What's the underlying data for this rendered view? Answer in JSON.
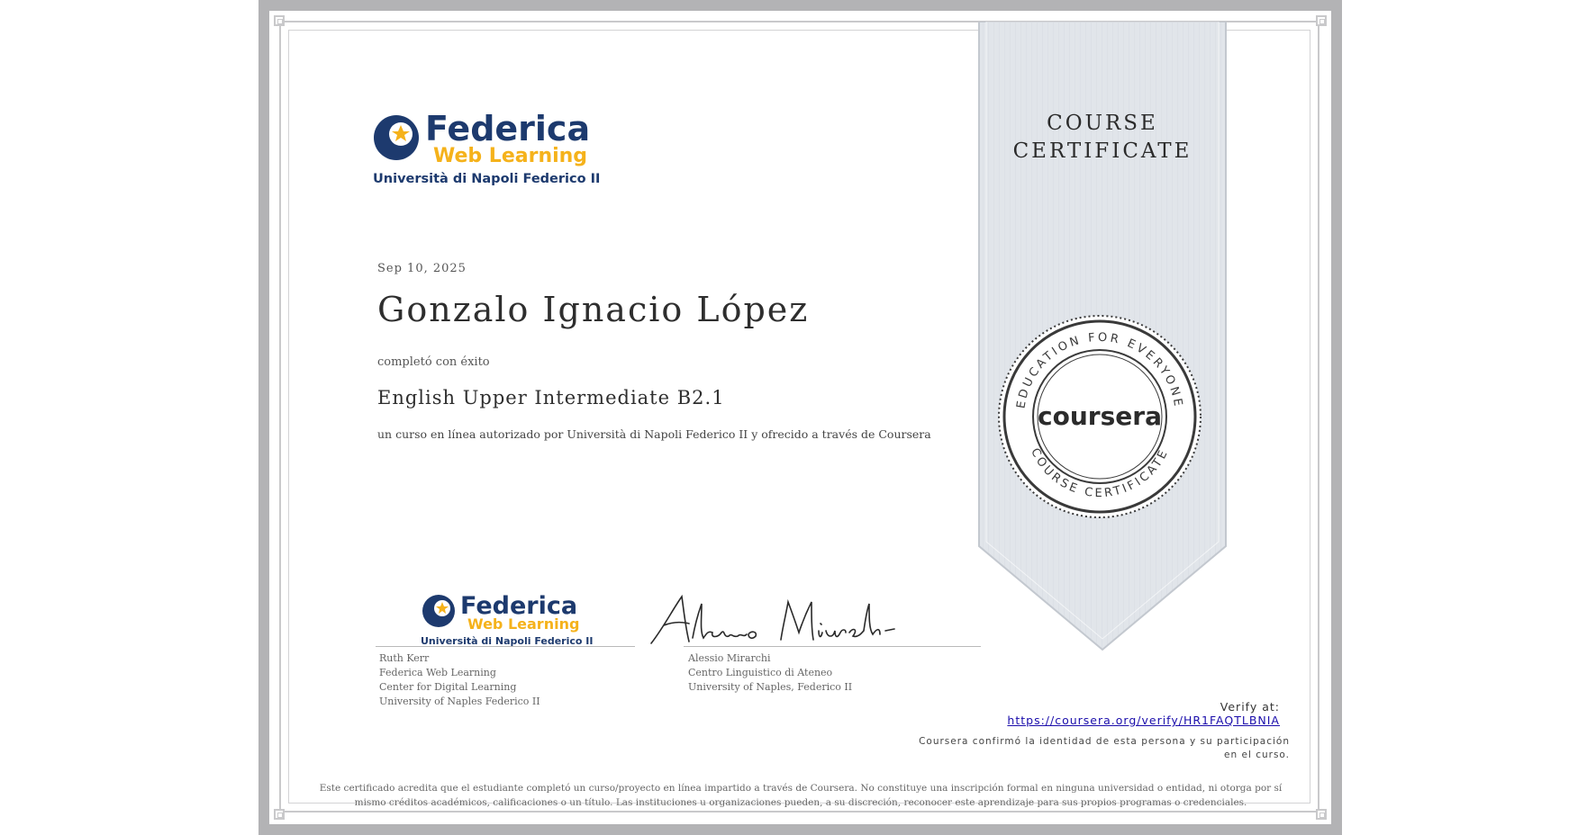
{
  "certificate": {
    "ribbon_title_line1": "COURSE",
    "ribbon_title_line2": "CERTIFICATE",
    "date": "Sep 10, 2025",
    "recipient_name": "Gonzalo Ignacio López",
    "completed_text": "completó con éxito",
    "course_name": "English Upper Intermediate B2.1",
    "course_description": "un curso en línea autorizado por Università di Napoli Federico II y ofrecido a través de Coursera",
    "verify_label": "Verify at:",
    "verify_url": "https://coursera.org/verify/HR1FAQTLBNIA",
    "confirm_text": "Coursera confirmó la identidad de esta persona y su participación en el curso.",
    "disclaimer": "Este certificado acredita que el estudiante completó un curso/proyecto en línea impartido a través de Coursera. No constituye una inscripción formal en ninguna universidad o entidad, ni otorga por sí mismo créditos académicos, calificaciones o un título. Las instituciones u organizaciones pueden, a su discreción, reconocer este aprendizaje para sus propios programas o credenciales."
  },
  "logo": {
    "line1": "Federica",
    "line2": "Web Learning",
    "line3": "Università di Napoli Federico II"
  },
  "seal": {
    "top_text": "EDUCATION FOR EVERYONE",
    "bottom_text": "COURSE CERTIFICATE",
    "center_text": "coursera"
  },
  "signatories": [
    {
      "name": "Ruth Kerr",
      "line2": "Federica Web Learning",
      "line3": "Center for Digital Learning",
      "line4": "University of Naples Federico II"
    },
    {
      "name": "Alessio Mirarchi",
      "line2": "Centro Linguistico di Ateneo",
      "line3": "University of Naples, Federico II",
      "signature": "Alessio Mirarchi"
    }
  ],
  "colors": {
    "navy": "#1d3a6e",
    "gold": "#f5b21b",
    "ribbon": "#e3e7ec",
    "border": "#b3b3b5",
    "link": "#1a0dab"
  }
}
